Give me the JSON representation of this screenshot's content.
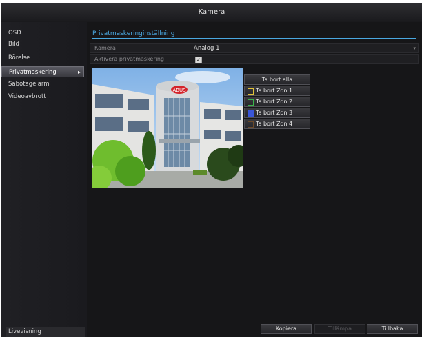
{
  "window": {
    "title": "Kamera"
  },
  "sidebar": {
    "items": [
      {
        "label": "OSD"
      },
      {
        "label": "Bild"
      },
      {
        "label": "Rörelse"
      },
      {
        "label": "Privatmaskering"
      },
      {
        "label": "Sabotagelarm"
      },
      {
        "label": "Videoavbrott"
      }
    ],
    "active_index": 3,
    "live_view": "Livevisning"
  },
  "main": {
    "section_title": "Privatmaskeringinställning",
    "camera": {
      "label": "Kamera",
      "value": "Analog 1"
    },
    "enable": {
      "label": "Aktivera privatmaskering",
      "checked": true
    },
    "preview": {
      "sign_text": "ABUS"
    },
    "buttons": {
      "delete_all": "Ta bort alla",
      "zones": [
        {
          "label": "Ta bort Zon 1",
          "color": "#e0c23a"
        },
        {
          "label": "Ta bort Zon 2",
          "color": "#3ab34a"
        },
        {
          "label": "Ta bort Zon 3",
          "color": "#3a56d8"
        },
        {
          "label": "Ta bort Zon 4",
          "color": "#6b4a2a"
        }
      ]
    }
  },
  "footer": {
    "copy": "Kopiera",
    "apply": "Tillämpa",
    "back": "Tillbaka"
  }
}
